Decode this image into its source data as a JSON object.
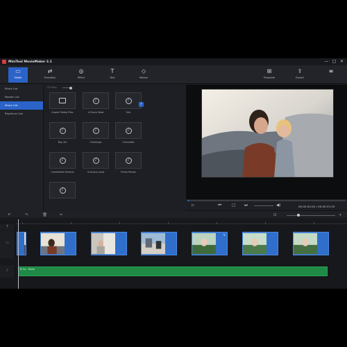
{
  "app": {
    "title": "MiniTool MovieMaker 2.1"
  },
  "window_controls": [
    "—",
    "□",
    "✕"
  ],
  "toolbar": {
    "media": "Media",
    "transition": "Transition",
    "effect": "Effect",
    "text": "Text",
    "motion": "Motion",
    "template": "Template",
    "export": "Export",
    "menu_icon": "≡"
  },
  "sidebar": {
    "items": [
      {
        "label": "Music List"
      },
      {
        "label": "Master List"
      },
      {
        "label": "Music List"
      },
      {
        "label": "Rhythmic List"
      }
    ],
    "active_index": 2
  },
  "library": {
    "tabs": [
      "All Music"
    ],
    "items": [
      {
        "label": "Import Media Files"
      },
      {
        "label": "A Drunk Beat"
      },
      {
        "label": "Folk"
      },
      {
        "label": "Bay Art"
      },
      {
        "label": "Challenge"
      },
      {
        "label": "Chocolate"
      },
      {
        "label": "Combatted Dreams"
      },
      {
        "label": "Gracious Jump"
      },
      {
        "label": "Photo Moves"
      },
      {
        "label": ""
      }
    ]
  },
  "preview": {
    "timecode": "00:00:00.00 / 00:00:33.03",
    "progress": 0.01
  },
  "timeline": {
    "music_label": "B Go  ·  Bone",
    "clip_count": 6
  },
  "colors": {
    "accent": "#2b63c9",
    "clip": "#2f6fcb",
    "music": "#1f8a45"
  }
}
